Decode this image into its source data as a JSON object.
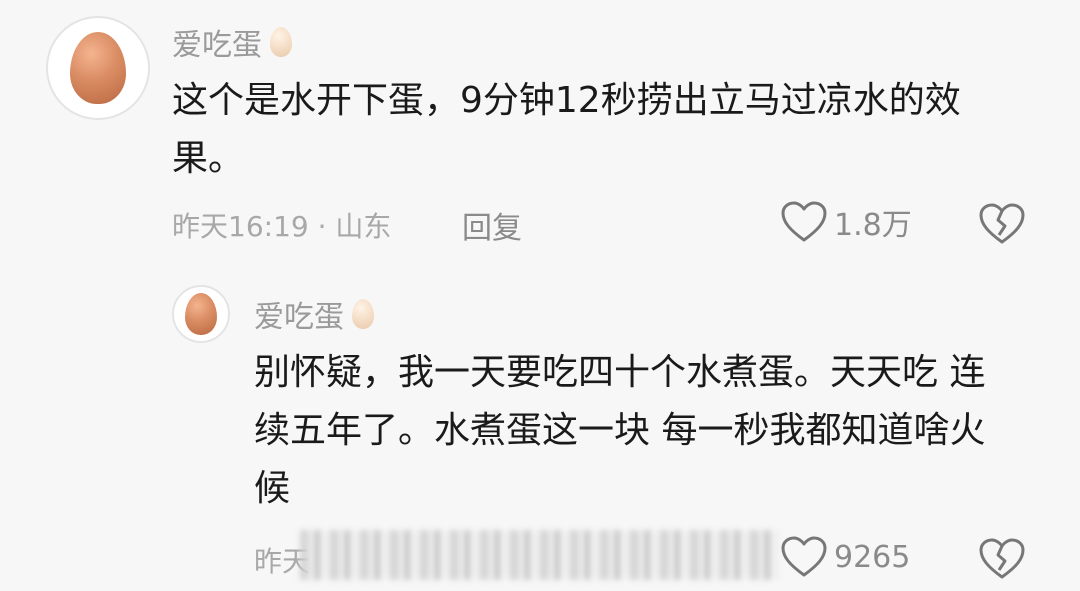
{
  "comment": {
    "username": "爱吃蛋",
    "text_line1": "这个是水开下蛋，9分钟12秒捞出立马过凉水的效",
    "text_line2": "果。",
    "time_location": "昨天16:19 · 山东",
    "reply_label": "回复",
    "like_count": "1.8万"
  },
  "reply": {
    "username": "爱吃蛋",
    "text_line1": "别怀疑，我一天要吃四十个水煮蛋。天天吃 连",
    "text_line2": "续五年了。水煮蛋这一块 每一秒我都知道啥火",
    "text_line3": "候",
    "time_prefix": "昨天",
    "like_count": "9265"
  },
  "icons": {
    "like": "heart-outline-icon",
    "dislike": "broken-heart-icon"
  }
}
